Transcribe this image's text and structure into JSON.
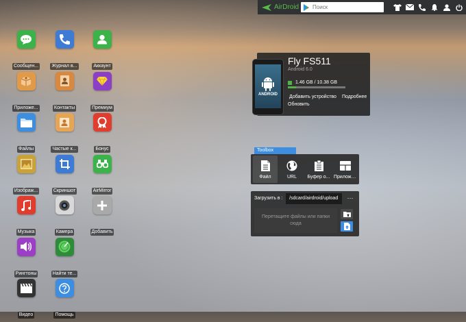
{
  "topbar": {
    "brand": "AirDroid",
    "search_placeholder": "Поиск",
    "icons": [
      "tshirt-icon",
      "mail-icon",
      "phone-icon",
      "bell-icon",
      "person-icon",
      "power-icon"
    ]
  },
  "apps": [
    {
      "label": "Сообщен...",
      "icon": "chat-icon",
      "color": "#3cb34a"
    },
    {
      "label": "Журнал в...",
      "icon": "call-log-icon",
      "color": "#3e7bd5"
    },
    {
      "label": "Аккаунт",
      "icon": "account-icon",
      "color": "#3cb34a"
    },
    {
      "label": "Приложе...",
      "icon": "box-icon",
      "color": "#e09a48"
    },
    {
      "label": "Контакты",
      "icon": "contacts-icon",
      "color": "#d9883f"
    },
    {
      "label": "Премиум",
      "icon": "diamond-icon",
      "color": "#8b3fc6"
    },
    {
      "label": "Файлы",
      "icon": "folder-icon",
      "color": "#3d8ee0"
    },
    {
      "label": "Частые к...",
      "icon": "frequent-contacts-icon",
      "color": "#e6a455"
    },
    {
      "label": "Бонус",
      "icon": "badge-icon",
      "color": "#e03d2e"
    },
    {
      "label": "Изображ...",
      "icon": "image-icon",
      "color": "#c9a23a"
    },
    {
      "label": "Скриншот",
      "icon": "crop-icon",
      "color": "#3e7bd5"
    },
    {
      "label": "AirMirror",
      "icon": "binoculars-icon",
      "color": "#3cb34a"
    },
    {
      "label": "Музыка",
      "icon": "music-icon",
      "color": "#e03d2e"
    },
    {
      "label": "Камера",
      "icon": "camera-icon",
      "color": "#d8d8d8"
    },
    {
      "label": "Добавить",
      "icon": "plus-icon",
      "color": "#a9a9a9"
    },
    {
      "label": "Рингтоны",
      "icon": "speaker-icon",
      "color": "#9b3fc6"
    },
    {
      "label": "Найти те...",
      "icon": "radar-icon",
      "color": "#2f8a3a"
    },
    {
      "label": "Видео",
      "icon": "clapper-icon",
      "color": "#333333"
    },
    {
      "label": "Помощь",
      "icon": "help-icon",
      "color": "#3d8ee0"
    }
  ],
  "device": {
    "name": "Fly FS511",
    "os": "Android 6.0",
    "storage": "1.46 GB / 10.38 GB",
    "storage_fraction": 0.14,
    "android_label": "ANDROID",
    "add_device": "Добавить устройство",
    "details": "Подробнее",
    "refresh": "Обновить"
  },
  "toolbox": {
    "title": "Toolbox",
    "tools": [
      {
        "label": "Файл",
        "icon": "file-icon"
      },
      {
        "label": "URL",
        "icon": "globe-icon"
      },
      {
        "label": "Буфер о...",
        "icon": "clipboard-icon"
      },
      {
        "label": "Приложе...",
        "icon": "app-box-icon"
      }
    ]
  },
  "upload": {
    "label": "Загрузить в :",
    "path": "/sdcard/airdroid/upload",
    "more": "···",
    "drop_text": "Перетащите файлы или папки сюда"
  }
}
